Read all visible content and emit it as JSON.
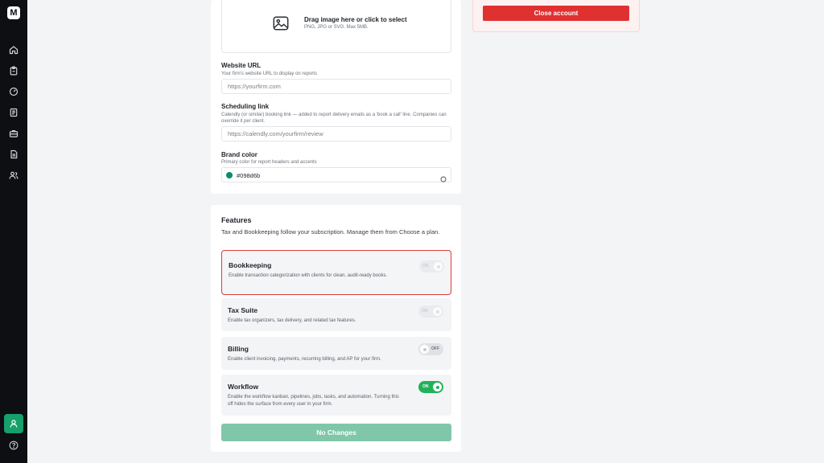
{
  "sidebar": {
    "logo_text": "M",
    "nav_items": [
      {
        "icon": "home-icon"
      },
      {
        "icon": "clipboard-icon"
      },
      {
        "icon": "gauge-icon"
      },
      {
        "icon": "document-icon"
      },
      {
        "icon": "briefcase-icon"
      },
      {
        "icon": "file-text-icon"
      },
      {
        "icon": "users-icon"
      }
    ],
    "profile_icon": "user-icon",
    "help_icon": "help-circle-icon"
  },
  "upload": {
    "title": "Drag image here or click to select",
    "subtitle": "PNG, JPG or SVG. Max 5MB."
  },
  "website": {
    "label": "Website URL",
    "help": "Your firm's website URL to display on reports",
    "placeholder": "https://yourfirm.com"
  },
  "scheduling": {
    "label": "Scheduling link",
    "help": "Calendly (or similar) booking link — added to report delivery emails as a 'book a call' line. Companies can override it per client.",
    "placeholder": "https://calendly.com/yourfirm/review"
  },
  "brand": {
    "label": "Brand color",
    "help": "Primary color for report headers and accents",
    "value": "#098d6b",
    "swatch": "#098d6b"
  },
  "danger": {
    "close_label": "Close account"
  },
  "features": {
    "title": "Features",
    "description": "Tax and Bookkeeping follow your subscription. Manage them from Choose a plan.",
    "items": [
      {
        "name": "Bookkeeping",
        "desc": "Enable transaction categorization with clients for clean, audit-ready books.",
        "state": "disabled",
        "toggle_text": "ON"
      },
      {
        "name": "Tax Suite",
        "desc": "Enable tax organizers, tax delivery, and related tax features.",
        "state": "disabled",
        "toggle_text": "ON"
      },
      {
        "name": "Billing",
        "desc": "Enable client invoicing, payments, recurring billing, and AP for your firm.",
        "state": "off",
        "toggle_text": "OFF"
      },
      {
        "name": "Workflow",
        "desc": "Enable the workflow kanban, pipelines, jobs, tasks, and automation. Turning this off hides the surface from every user in your firm.",
        "state": "on",
        "toggle_text": "ON"
      }
    ],
    "save_label": "No Changes"
  },
  "colors": {
    "accent": "#16a06a",
    "danger": "#e03131",
    "toggle_on": "#21b15a"
  }
}
